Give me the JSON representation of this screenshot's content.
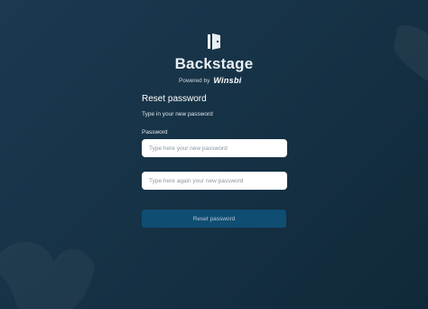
{
  "app": {
    "brand_name": "Backstage",
    "powered_by_text": "Powered by",
    "powered_by_brand": "Winsbi",
    "logo_icon": "door-icon"
  },
  "form": {
    "title": "Reset password",
    "subtitle": "Type in your new password",
    "password_label": "Password",
    "password_placeholder": "Type here your new password",
    "password_value": "",
    "confirm_placeholder": "Type here again your new password",
    "confirm_value": "",
    "submit_label": "Reset password"
  },
  "colors": {
    "background": "#173347",
    "button": "#0f4d72",
    "button_text": "#b7c9d6"
  }
}
